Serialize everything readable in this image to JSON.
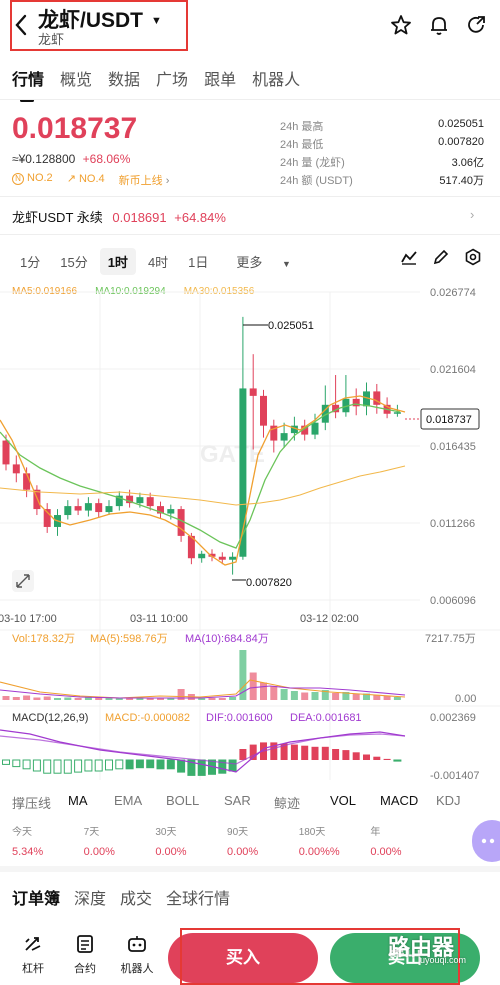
{
  "header": {
    "title": "龙虾/USDT",
    "subtitle": "龙虾",
    "highlight_color": "#e53935"
  },
  "nav": {
    "tabs": [
      "行情",
      "概览",
      "数据",
      "广场",
      "跟单",
      "机器人"
    ],
    "active": "行情"
  },
  "ticker": {
    "price": "0.018737",
    "cny": "≈¥0.128800",
    "change": "+68.06%",
    "rank1": "NO.2",
    "rank2": "NO.4",
    "new_listing": "新币上线",
    "stats": [
      {
        "label": "24h  最高",
        "value": "0.025051"
      },
      {
        "label": "24h  最低",
        "value": "0.007820"
      },
      {
        "label": "24h  量 (龙虾)",
        "value": "3.06亿"
      },
      {
        "label": "24h  额 (USDT)",
        "value": "517.40万"
      }
    ]
  },
  "perpetual": {
    "name": "龙虾USDT 永续",
    "price": "0.018691",
    "change": "+64.84%"
  },
  "timeframes": {
    "items": [
      "1分",
      "15分",
      "1时",
      "4时",
      "1日",
      "更多"
    ],
    "active": "1时"
  },
  "ma_legend": {
    "ma5": "MA5:0.019166",
    "ma10": "MA10:0.019294",
    "ma30": "MA30:0.015356"
  },
  "colors": {
    "up": "#2aa56a",
    "down": "#e0415a",
    "ma5": "#f0a030",
    "ma10": "#6bc45a",
    "ma30": "#f2b84b",
    "purple": "#a13ad0"
  },
  "price_axis": [
    "0.026774",
    "0.021604",
    "0.016435",
    "0.011266",
    "0.006096"
  ],
  "high_label": "0.025051",
  "low_label": "0.007820",
  "current_label": "0.018737",
  "time_axis": [
    "03-10 17:00",
    "03-11 10:00",
    "03-12 02:00"
  ],
  "volume": {
    "vol": "Vol:178.32万",
    "ma5": "MA(5):598.76万",
    "ma10": "MA(10):684.84万",
    "max": "7217.75万",
    "min": "0.00"
  },
  "macd": {
    "params": "MACD(12,26,9)",
    "macd": "MACD:-0.000082",
    "dif": "DIF:0.001600",
    "dea": "DEA:0.001681",
    "top": "0.002369",
    "bottom": "-0.001407"
  },
  "indicators": {
    "items": [
      "撑压线",
      "MA",
      "EMA",
      "BOLL",
      "SAR",
      "鲸迹",
      "VOL",
      "MACD",
      "KDJ"
    ],
    "active": [
      "MA",
      "VOL",
      "MACD"
    ]
  },
  "performance": [
    {
      "period": "今天",
      "value": "5.34%"
    },
    {
      "period": "7天",
      "value": "0.00%"
    },
    {
      "period": "30天",
      "value": "0.00%"
    },
    {
      "period": "90天",
      "value": "0.00%"
    },
    {
      "period": "180天",
      "value": "0.00%%"
    },
    {
      "period": "年",
      "value": "0.00%"
    }
  ],
  "bottom_tabs": {
    "items": [
      "订单簿",
      "深度",
      "成交",
      "全球行情"
    ],
    "active": "订单簿"
  },
  "footer": {
    "items": [
      "杠杆",
      "合约",
      "机器人"
    ],
    "buy": "买入",
    "sell": "卖出"
  },
  "watermark": {
    "text": "路由器",
    "sub": "luyouqi.com"
  },
  "chart_data": {
    "type": "candlestick",
    "ylim": [
      0.006096,
      0.026774
    ],
    "candles": [
      [
        0.0168,
        0.0152,
        0.0172,
        0.0148
      ],
      [
        0.0152,
        0.0146,
        0.0158,
        0.014
      ],
      [
        0.0146,
        0.0135,
        0.015,
        0.013
      ],
      [
        0.0135,
        0.0122,
        0.0138,
        0.0118
      ],
      [
        0.0122,
        0.011,
        0.0126,
        0.0106
      ],
      [
        0.011,
        0.0118,
        0.0122,
        0.0104
      ],
      [
        0.0118,
        0.0124,
        0.0128,
        0.0115
      ],
      [
        0.0124,
        0.0121,
        0.0129,
        0.0118
      ],
      [
        0.0121,
        0.0126,
        0.013,
        0.0117
      ],
      [
        0.0126,
        0.012,
        0.0129,
        0.0116
      ],
      [
        0.012,
        0.0124,
        0.0128,
        0.0118
      ],
      [
        0.0124,
        0.0131,
        0.0134,
        0.0121
      ],
      [
        0.0131,
        0.0126,
        0.0135,
        0.0123
      ],
      [
        0.0126,
        0.013,
        0.0133,
        0.0123
      ],
      [
        0.013,
        0.0124,
        0.0133,
        0.0121
      ],
      [
        0.0124,
        0.0119,
        0.0127,
        0.0116
      ],
      [
        0.0119,
        0.0122,
        0.0125,
        0.0115
      ],
      [
        0.0122,
        0.0104,
        0.0124,
        0.01
      ],
      [
        0.0104,
        0.0089,
        0.0106,
        0.0085
      ],
      [
        0.0089,
        0.0092,
        0.0094,
        0.0086
      ],
      [
        0.0092,
        0.009,
        0.0095,
        0.0087
      ],
      [
        0.009,
        0.0088,
        0.0093,
        0.0085
      ],
      [
        0.0088,
        0.009,
        0.0093,
        0.0078
      ],
      [
        0.009,
        0.0203,
        0.0251,
        0.0088
      ],
      [
        0.0203,
        0.0198,
        0.0226,
        0.0162
      ],
      [
        0.0198,
        0.0178,
        0.0202,
        0.017
      ],
      [
        0.0178,
        0.0168,
        0.0182,
        0.016
      ],
      [
        0.0168,
        0.0173,
        0.018,
        0.0163
      ],
      [
        0.0173,
        0.0178,
        0.0184,
        0.0168
      ],
      [
        0.0178,
        0.0172,
        0.0182,
        0.0168
      ],
      [
        0.0172,
        0.018,
        0.0186,
        0.0169
      ],
      [
        0.018,
        0.0192,
        0.0205,
        0.0175
      ],
      [
        0.0192,
        0.0187,
        0.0212,
        0.0183
      ],
      [
        0.0187,
        0.0196,
        0.0212,
        0.0184
      ],
      [
        0.0196,
        0.0191,
        0.0203,
        0.0185
      ],
      [
        0.0191,
        0.0201,
        0.0207,
        0.0185
      ],
      [
        0.0201,
        0.0192,
        0.0206,
        0.0186
      ],
      [
        0.0192,
        0.0186,
        0.0197,
        0.0183
      ],
      [
        0.0186,
        0.0187,
        0.0192,
        0.0184
      ]
    ]
  }
}
